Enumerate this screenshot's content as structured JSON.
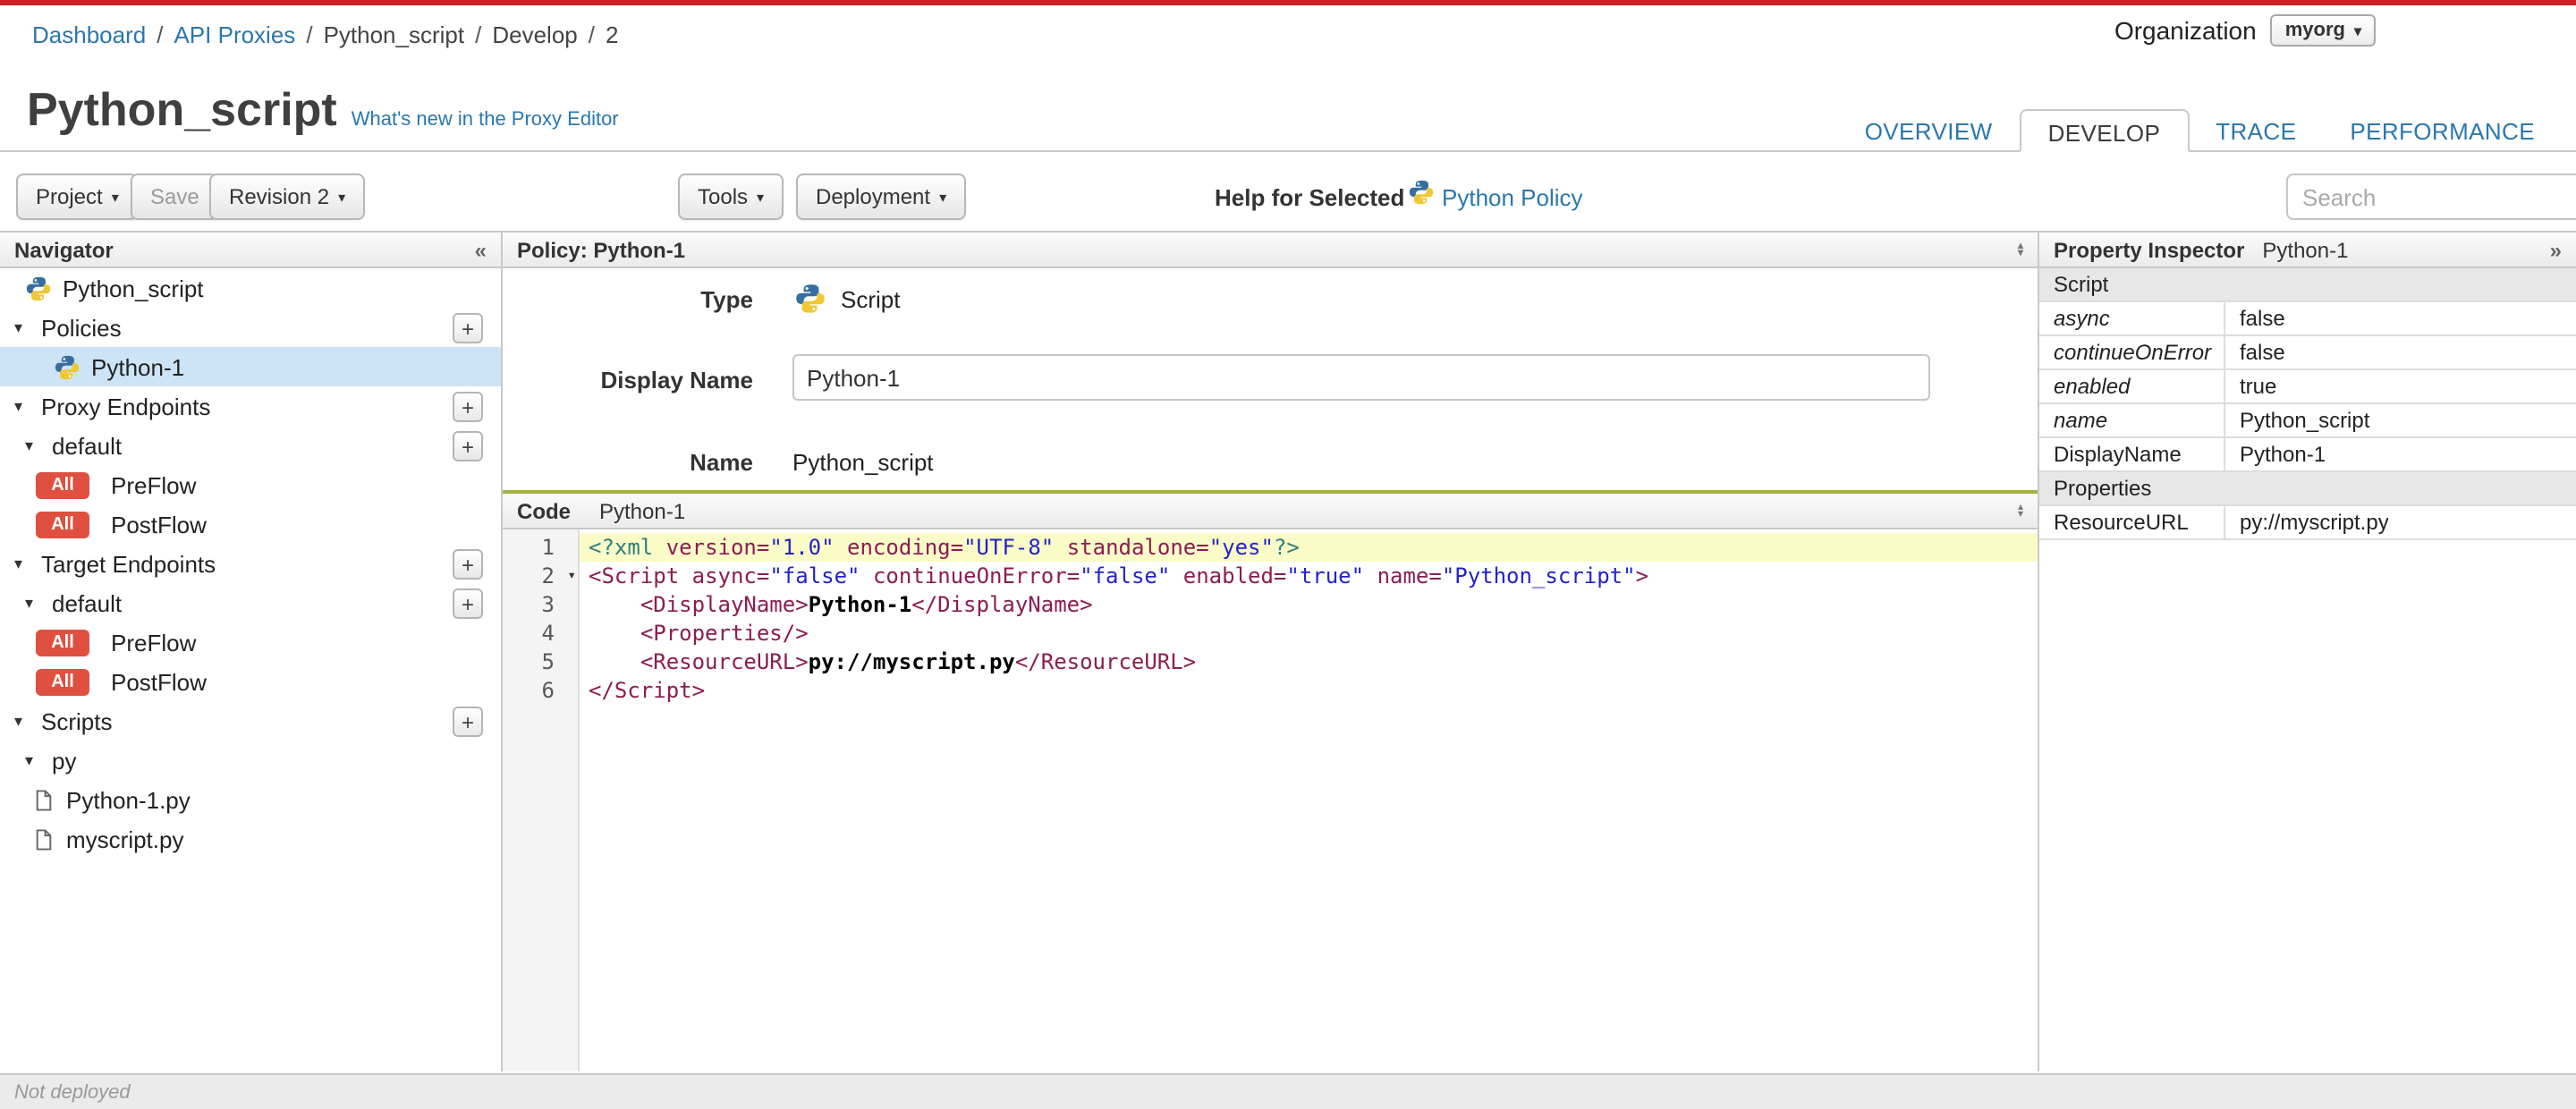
{
  "breadcrumb": {
    "separator": "/",
    "items": [
      "Dashboard",
      "API Proxies",
      "Python_script",
      "Develop",
      "2"
    ]
  },
  "organization": {
    "label": "Organization",
    "value": "myorg"
  },
  "header": {
    "title": "Python_script",
    "whats_new_link": "What's new in the Proxy Editor",
    "tabs": [
      "OVERVIEW",
      "DEVELOP",
      "TRACE",
      "PERFORMANCE"
    ],
    "active_tab": "DEVELOP"
  },
  "toolbar": {
    "project": "Project",
    "save": "Save",
    "revision": "Revision 2",
    "tools": "Tools",
    "deployment": "Deployment",
    "help_for_selected": "Help for Selected",
    "help_link": "Python Policy",
    "search_placeholder": "Search"
  },
  "navigator": {
    "title": "Navigator",
    "items": [
      {
        "label": "Python_script"
      },
      {
        "label": "Policies"
      },
      {
        "label": "Python-1"
      },
      {
        "label": "Proxy Endpoints"
      },
      {
        "label": "default"
      },
      {
        "label": "PreFlow",
        "badge": "All"
      },
      {
        "label": "PostFlow",
        "badge": "All"
      },
      {
        "label": "Target Endpoints"
      },
      {
        "label": "default"
      },
      {
        "label": "PreFlow",
        "badge": "All"
      },
      {
        "label": "PostFlow",
        "badge": "All"
      },
      {
        "label": "Scripts"
      },
      {
        "label": "py"
      },
      {
        "label": "Python-1.py"
      },
      {
        "label": "myscript.py"
      }
    ]
  },
  "policy_panel": {
    "title": "Policy: Python-1",
    "type_label": "Type",
    "type_value": "Script",
    "display_name_label": "Display Name",
    "display_name_value": "Python-1",
    "name_label": "Name",
    "name_value": "Python_script"
  },
  "code_panel": {
    "title": "Code",
    "subtitle": "Python-1",
    "lines": [
      [
        [
          "m",
          "<?xml"
        ],
        [
          "p",
          " "
        ],
        [
          "a",
          "version="
        ],
        [
          "s",
          "\"1.0\""
        ],
        [
          "p",
          " "
        ],
        [
          "a",
          "encoding="
        ],
        [
          "s",
          "\"UTF-8\""
        ],
        [
          "p",
          " "
        ],
        [
          "a",
          "standalone="
        ],
        [
          "s",
          "\"yes\""
        ],
        [
          "m",
          "?>"
        ]
      ],
      [
        [
          "t",
          "<Script"
        ],
        [
          "p",
          " "
        ],
        [
          "a",
          "async="
        ],
        [
          "s",
          "\"false\""
        ],
        [
          "p",
          " "
        ],
        [
          "a",
          "continueOnError="
        ],
        [
          "s",
          "\"false\""
        ],
        [
          "p",
          " "
        ],
        [
          "a",
          "enabled="
        ],
        [
          "s",
          "\"true\""
        ],
        [
          "p",
          " "
        ],
        [
          "a",
          "name="
        ],
        [
          "s",
          "\"Python_script\""
        ],
        [
          "t",
          ">"
        ]
      ],
      [
        [
          "p",
          "    "
        ],
        [
          "t",
          "<DisplayName>"
        ],
        [
          "x",
          "Python-1"
        ],
        [
          "t",
          "</DisplayName>"
        ]
      ],
      [
        [
          "p",
          "    "
        ],
        [
          "t",
          "<Properties/>"
        ]
      ],
      [
        [
          "p",
          "    "
        ],
        [
          "t",
          "<ResourceURL>"
        ],
        [
          "x",
          "py://myscript.py"
        ],
        [
          "t",
          "</ResourceURL>"
        ]
      ],
      [
        [
          "t",
          "</Script>"
        ]
      ]
    ]
  },
  "property_inspector": {
    "title": "Property Inspector",
    "subtitle": "Python-1",
    "rows": [
      {
        "type": "section",
        "label": "Script"
      },
      {
        "type": "prop",
        "label": "async",
        "value": "false"
      },
      {
        "type": "prop",
        "label": "continueOnError",
        "value": "false"
      },
      {
        "type": "prop",
        "label": "enabled",
        "value": "true"
      },
      {
        "type": "prop",
        "label": "name",
        "value": "Python_script"
      },
      {
        "type": "prop",
        "label": "DisplayName",
        "value": "Python-1"
      },
      {
        "type": "section",
        "label": "Properties"
      },
      {
        "type": "prop",
        "label": "ResourceURL",
        "value": "py://myscript.py"
      }
    ]
  },
  "status_bar": {
    "text": "Not deployed"
  },
  "colors": {
    "brand_red": "#cc2127",
    "link_blue": "#2a77ad",
    "badge_red": "#df5040",
    "selection_blue": "#cce4f6",
    "splitter_green": "#a6b240"
  }
}
